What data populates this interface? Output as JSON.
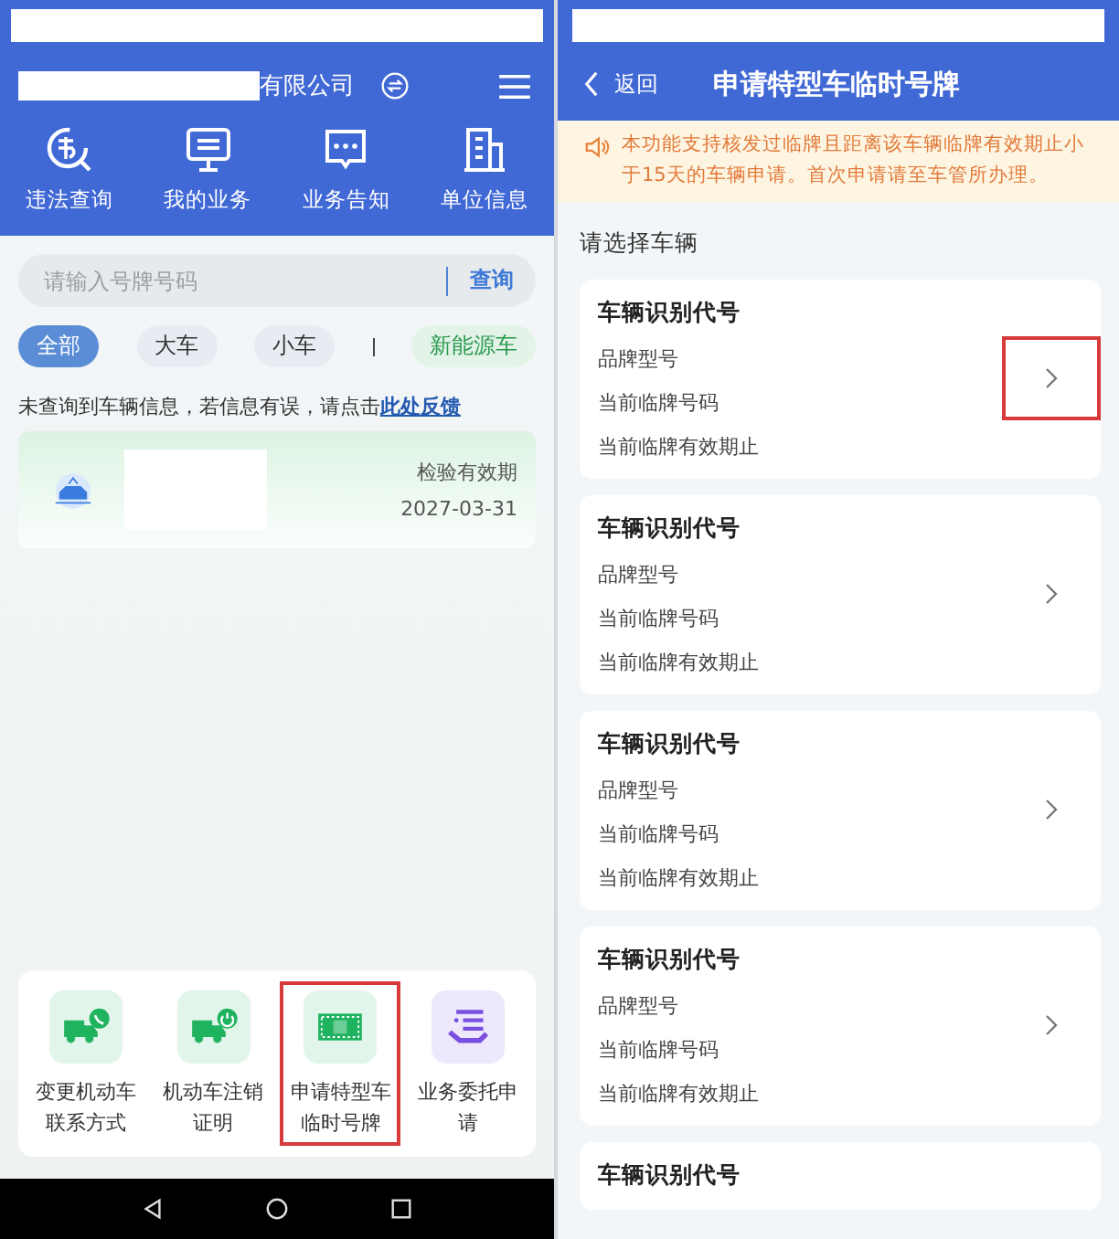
{
  "left": {
    "company_suffix": "有限公司",
    "quick_actions": [
      {
        "label": "违法查询",
        "kind": "violation"
      },
      {
        "label": "我的业务",
        "kind": "monitor"
      },
      {
        "label": "业务告知",
        "kind": "chat"
      },
      {
        "label": "单位信息",
        "kind": "building"
      }
    ],
    "search": {
      "placeholder": "请输入号牌号码",
      "button": "查询"
    },
    "filters": [
      {
        "label": "全部",
        "selected": true,
        "kind": "normal"
      },
      {
        "label": "大车",
        "selected": false,
        "kind": "normal"
      },
      {
        "label": "小车",
        "selected": false,
        "kind": "normal"
      },
      {
        "label": "新能源车",
        "selected": false,
        "kind": "new-energy"
      }
    ],
    "notice": "未查询到车辆信息，若信息有误，请点击",
    "notice_link": "此处反馈",
    "vehicle_card": {
      "label": "检验有效期",
      "date": "2027-03-31"
    },
    "services": [
      {
        "label": "变更机动车联系方式",
        "kind": "truck-phone",
        "color": "#1fb35f",
        "highlighted": false
      },
      {
        "label": "机动车注销证明",
        "kind": "truck-power",
        "color": "#1fb35f",
        "highlighted": false
      },
      {
        "label": "申请特型车临时号牌",
        "kind": "plate",
        "color": "#1fb35f",
        "highlighted": true
      },
      {
        "label": "业务委托申请",
        "kind": "hand-list",
        "color": "#7a4fe0",
        "highlighted": false
      }
    ]
  },
  "right": {
    "back": "返回",
    "title": "申请特型车临时号牌",
    "notice": "本功能支持核发过临牌且距离该车辆临牌有效期止小于15天的车辆申请。首次申请请至车管所办理。",
    "section_title": "请选择车辆",
    "vehicles": [
      {
        "title": "车辆识别代号",
        "fields": [
          "品牌型号",
          "当前临牌号码",
          "当前临牌有效期止"
        ],
        "highlighted": true
      },
      {
        "title": "车辆识别代号",
        "fields": [
          "品牌型号",
          "当前临牌号码",
          "当前临牌有效期止"
        ],
        "highlighted": false
      },
      {
        "title": "车辆识别代号",
        "fields": [
          "品牌型号",
          "当前临牌号码",
          "当前临牌有效期止"
        ],
        "highlighted": false
      },
      {
        "title": "车辆识别代号",
        "fields": [
          "品牌型号",
          "当前临牌号码",
          "当前临牌有效期止"
        ],
        "highlighted": false
      },
      {
        "title": "车辆识别代号"
      }
    ]
  }
}
